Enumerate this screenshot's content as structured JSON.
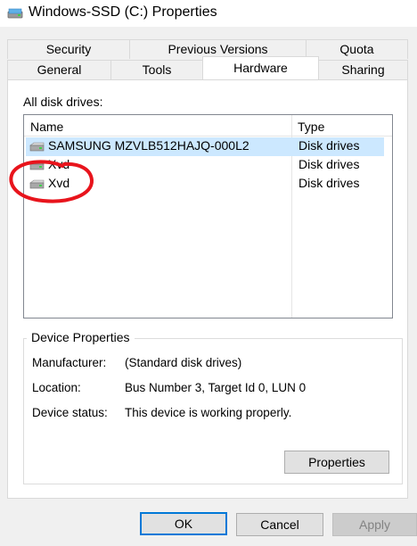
{
  "window": {
    "title": "Windows-SSD (C:) Properties",
    "title_icon": "drive-icon"
  },
  "tabs": {
    "row_back": [
      "Security",
      "Previous Versions",
      "Quota"
    ],
    "row_front": [
      "General",
      "Tools",
      "Hardware",
      "Sharing"
    ],
    "active": "Hardware"
  },
  "hardware": {
    "list_label": "All disk drives:",
    "columns": [
      "Name",
      "Type"
    ],
    "drives": [
      {
        "name": "SAMSUNG MZVLB512HAJQ-000L2",
        "type": "Disk drives",
        "selected": true,
        "icon": "disk-drive-icon"
      },
      {
        "name": "Xvd",
        "type": "Disk drives",
        "selected": false,
        "icon": "disk-drive-icon"
      },
      {
        "name": "Xvd",
        "type": "Disk drives",
        "selected": false,
        "icon": "disk-drive-icon"
      }
    ]
  },
  "device_properties": {
    "title": "Device Properties",
    "manufacturer_label": "Manufacturer:",
    "manufacturer_value": "(Standard disk drives)",
    "location_label": "Location:",
    "location_value": "Bus Number 3, Target Id 0, LUN 0",
    "status_label": "Device status:",
    "status_value": "This device is working properly.",
    "properties_button": "Properties"
  },
  "buttons": {
    "ok": "OK",
    "cancel": "Cancel",
    "apply": "Apply"
  },
  "colors": {
    "selection": "#cce8ff",
    "default_button_border": "#0078d7",
    "annotation": "#e8141c"
  }
}
